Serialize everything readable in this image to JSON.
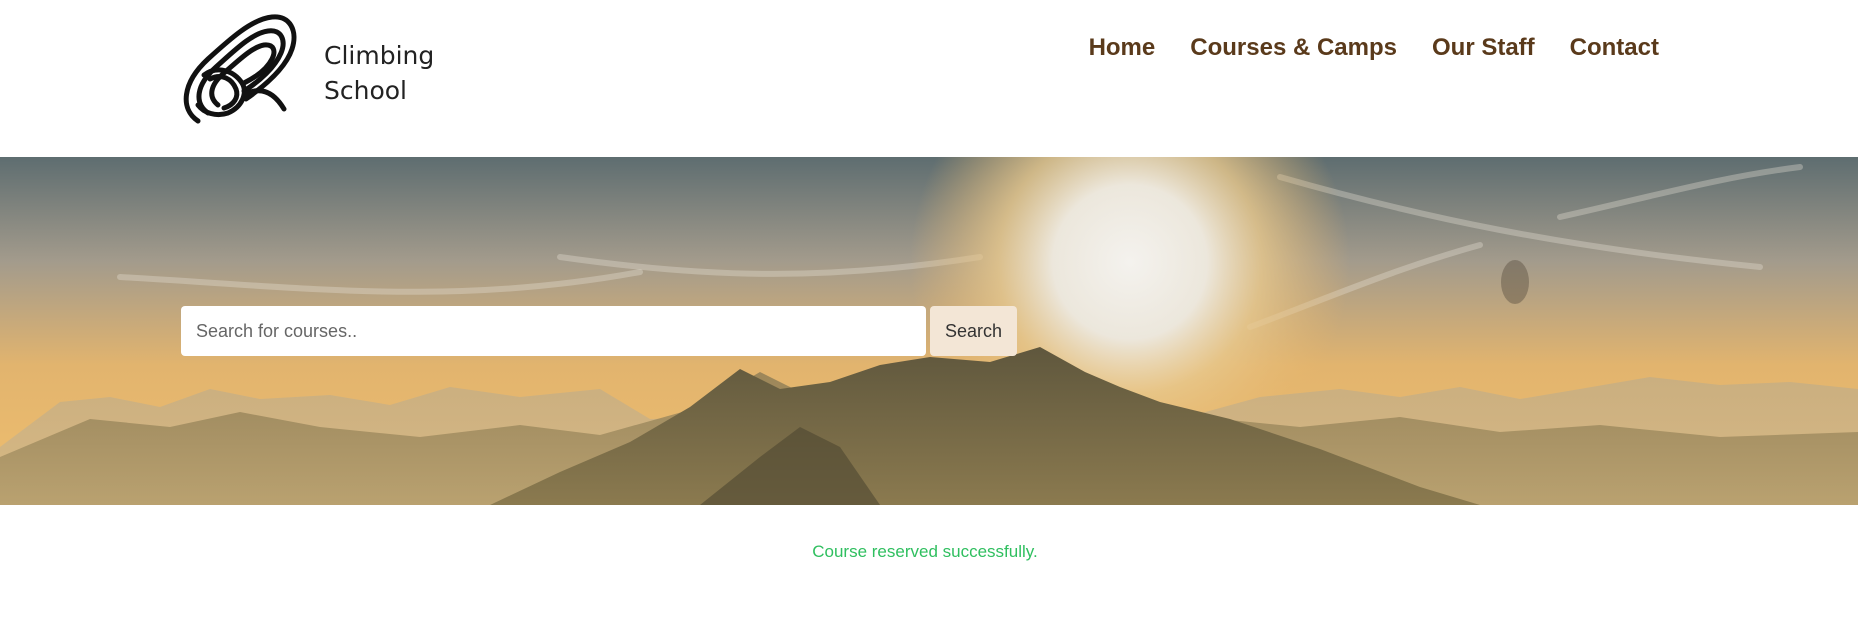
{
  "brand": {
    "name_line1": "Climbing",
    "name_line2": "School",
    "logo_icon": "rope-coil-icon"
  },
  "nav": {
    "items": [
      {
        "label": "Home"
      },
      {
        "label": "Courses & Camps"
      },
      {
        "label": "Our Staff"
      },
      {
        "label": "Contact"
      }
    ],
    "color": "#5a3a1b"
  },
  "hero": {
    "image": "mountain-sunset-banner"
  },
  "search": {
    "placeholder": "Search for courses..",
    "value": "",
    "button_label": "Search"
  },
  "status": {
    "message": "Course reserved successfully.",
    "color": "#2fbf5f"
  }
}
